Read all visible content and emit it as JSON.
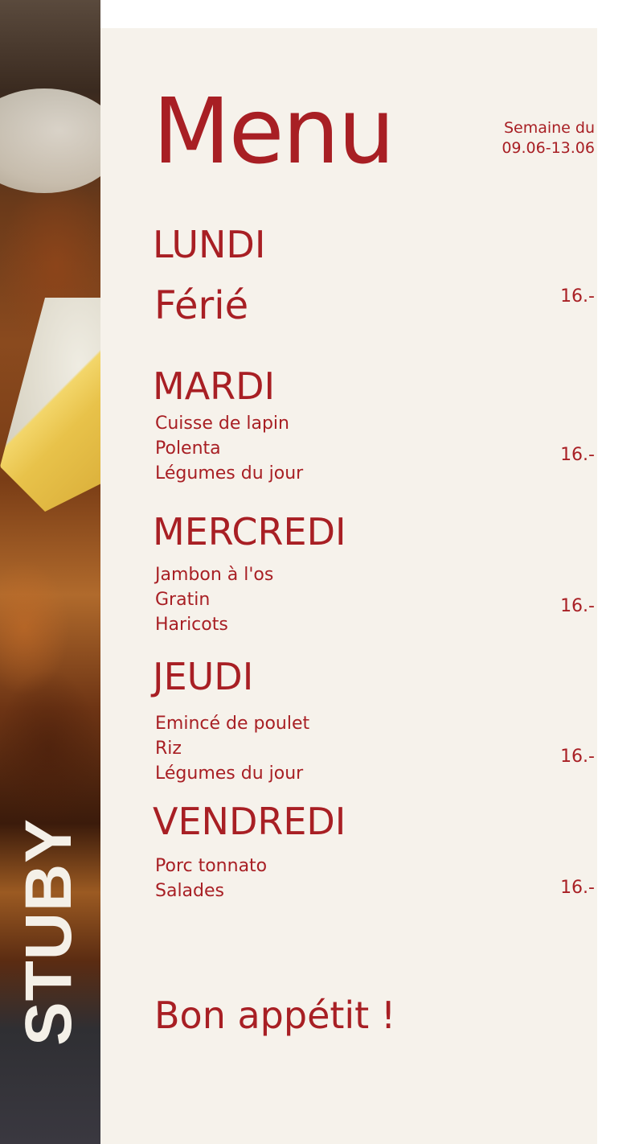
{
  "brand": "STUBY",
  "menu": {
    "title": "Menu",
    "week_label": "Semaine du",
    "week_dates": "09.06-13.06",
    "days": [
      {
        "name": "LUNDI",
        "dishes": [
          "Férié"
        ],
        "price": "16.-"
      },
      {
        "name": "MARDI",
        "dishes": [
          "Cuisse de lapin",
          "Polenta",
          "Légumes du jour"
        ],
        "price": "16.-"
      },
      {
        "name": "MERCREDI",
        "dishes": [
          "Jambon à l'os",
          "Gratin",
          "Haricots"
        ],
        "price": "16.-"
      },
      {
        "name": "JEUDI",
        "dishes": [
          "Emincé de poulet",
          "Riz",
          "Légumes du jour"
        ],
        "price": "16.-"
      },
      {
        "name": "VENDREDI",
        "dishes": [
          "Porc tonnato",
          "Salades"
        ],
        "price": "16.-"
      }
    ],
    "closing": "Bon appétit !"
  },
  "colors": {
    "accent": "#a81f24",
    "panel": "#f6f2eb",
    "brand_text": "#f4f0e8"
  }
}
